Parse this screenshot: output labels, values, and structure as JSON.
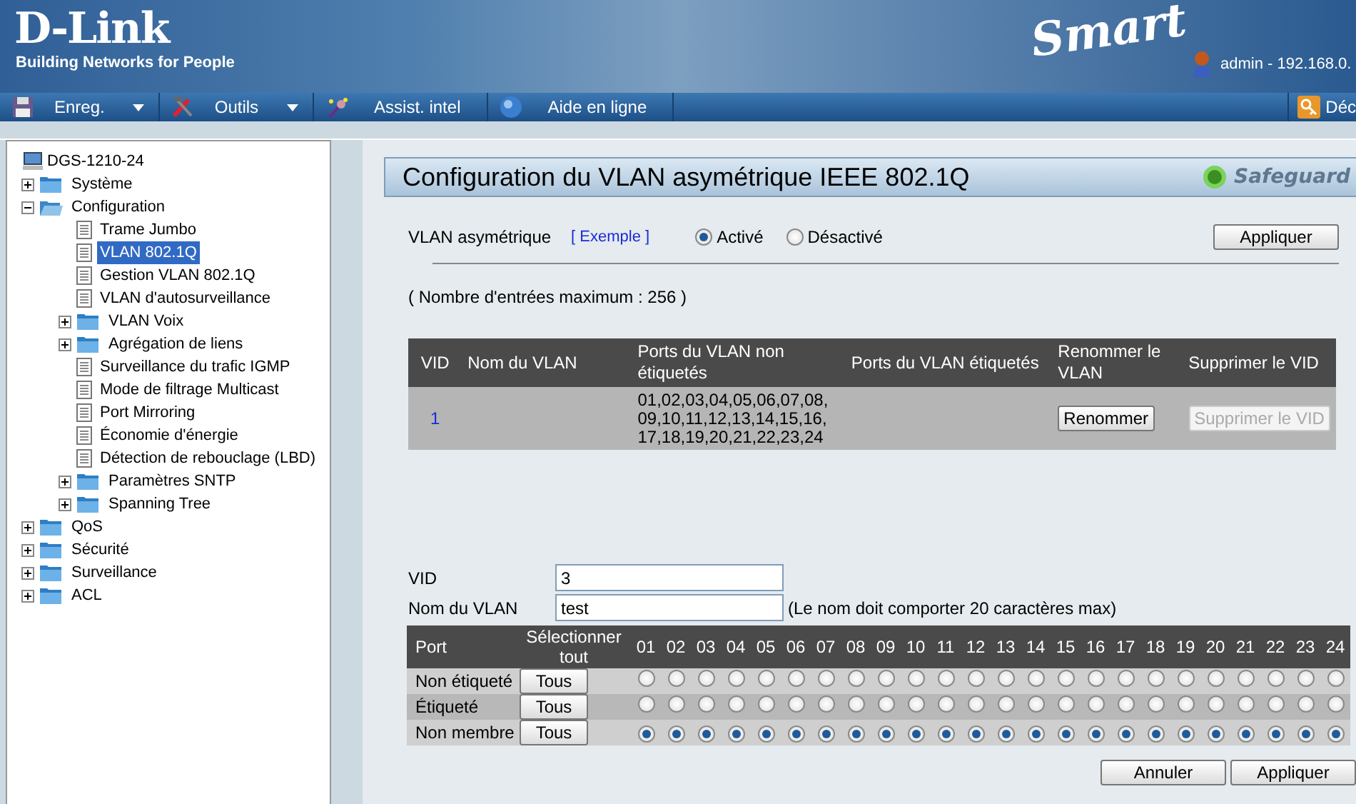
{
  "header": {
    "logo": "D-Link",
    "tagline": "Building Networks for People",
    "product": "Smart",
    "user": "admin - 192.168.0."
  },
  "toolbar": {
    "items": [
      {
        "kind": "save",
        "label": "Enreg.",
        "dropdown": true
      },
      {
        "kind": "tools",
        "label": "Outils",
        "dropdown": true
      },
      {
        "kind": "wizard",
        "label": "Assist. intel",
        "dropdown": false
      },
      {
        "kind": "help",
        "label": "Aide en ligne",
        "dropdown": false
      }
    ],
    "logout": "Déc"
  },
  "tree": {
    "label": "DGS-1210-24",
    "children": [
      {
        "kind": "folder",
        "label": "Système",
        "expanded": false,
        "selected": false
      },
      {
        "kind": "folder",
        "label": "Configuration",
        "expanded": true,
        "selected": false,
        "children": [
          {
            "kind": "page",
            "label": "Trame Jumbo",
            "selected": false
          },
          {
            "kind": "page",
            "label": "VLAN 802.1Q",
            "selected": true
          },
          {
            "kind": "page",
            "label": "Gestion VLAN 802.1Q",
            "selected": false
          },
          {
            "kind": "page",
            "label": "VLAN d'autosurveillance",
            "selected": false
          },
          {
            "kind": "folder",
            "label": "VLAN Voix",
            "expanded": false,
            "selected": false
          },
          {
            "kind": "folder",
            "label": "Agrégation de liens",
            "expanded": false,
            "selected": false
          },
          {
            "kind": "page",
            "label": "Surveillance du trafic IGMP",
            "selected": false
          },
          {
            "kind": "page",
            "label": "Mode de filtrage Multicast",
            "selected": false
          },
          {
            "kind": "page",
            "label": "Port Mirroring",
            "selected": false
          },
          {
            "kind": "page",
            "label": "Économie d'énergie",
            "selected": false
          },
          {
            "kind": "page",
            "label": "Détection de rebouclage (LBD)",
            "selected": false
          },
          {
            "kind": "folder",
            "label": "Paramètres SNTP",
            "expanded": false,
            "selected": false
          },
          {
            "kind": "folder",
            "label": "Spanning Tree",
            "expanded": false,
            "selected": false
          }
        ]
      },
      {
        "kind": "folder",
        "label": "QoS",
        "expanded": false,
        "selected": false
      },
      {
        "kind": "folder",
        "label": "Sécurité",
        "expanded": false,
        "selected": false
      },
      {
        "kind": "folder",
        "label": "Surveillance",
        "expanded": false,
        "selected": false
      },
      {
        "kind": "folder",
        "label": "ACL",
        "expanded": false,
        "selected": false
      }
    ]
  },
  "panel": {
    "title": "Configuration du VLAN asymétrique IEEE 802.1Q",
    "safeguard": "Safeguard"
  },
  "asymmetric": {
    "label": "VLAN asymétrique",
    "link": "[ Exemple ]",
    "options": [
      {
        "label": "Activé",
        "selected": true
      },
      {
        "label": "Désactivé",
        "selected": false
      }
    ],
    "apply": "Appliquer"
  },
  "max_entries": "( Nombre d'entrées maximum : 256 )",
  "vlan_table": {
    "columns": [
      "VID",
      "Nom du VLAN",
      "Ports du VLAN non étiquetés",
      "Ports du VLAN étiquetés",
      "Renommer le VLAN",
      "Supprimer le VID"
    ],
    "rows": [
      {
        "vid": "1",
        "untagged": "01,02,03,04,05,06,07,08, 09,10,11,12,13,14,15,16, 17,18,19,20,21,22,23,24",
        "rename": "Renommer",
        "delete": "Supprimer le VID",
        "delete_disabled": true
      }
    ]
  },
  "form": {
    "vid_label": "VID",
    "vid_value": "3",
    "name_label": "Nom du VLAN",
    "name_value": "test",
    "name_hint": "(Le nom doit comporter 20 caractères max)"
  },
  "port_table": {
    "port_header": "Port",
    "select_header": "Sélectionner tout",
    "ports": [
      "01",
      "02",
      "03",
      "04",
      "05",
      "06",
      "07",
      "08",
      "09",
      "10",
      "11",
      "12",
      "13",
      "14",
      "15",
      "16",
      "17",
      "18",
      "19",
      "20",
      "21",
      "22",
      "23",
      "24"
    ],
    "rows": [
      {
        "label": "Non étiqueté",
        "button": "Tous",
        "cells": [
          {
            "selected": false
          },
          {
            "selected": false
          },
          {
            "selected": false
          },
          {
            "selected": false
          },
          {
            "selected": false
          },
          {
            "selected": false
          },
          {
            "selected": false
          },
          {
            "selected": false
          },
          {
            "selected": false
          },
          {
            "selected": false
          },
          {
            "selected": false
          },
          {
            "selected": false
          },
          {
            "selected": false
          },
          {
            "selected": false
          },
          {
            "selected": false
          },
          {
            "selected": false
          },
          {
            "selected": false
          },
          {
            "selected": false
          },
          {
            "selected": false
          },
          {
            "selected": false
          },
          {
            "selected": false
          },
          {
            "selected": false
          },
          {
            "selected": false
          },
          {
            "selected": false
          }
        ]
      },
      {
        "label": "Étiqueté",
        "button": "Tous",
        "cells": [
          {
            "selected": false
          },
          {
            "selected": false
          },
          {
            "selected": false
          },
          {
            "selected": false
          },
          {
            "selected": false
          },
          {
            "selected": false
          },
          {
            "selected": false
          },
          {
            "selected": false
          },
          {
            "selected": false
          },
          {
            "selected": false
          },
          {
            "selected": false
          },
          {
            "selected": false
          },
          {
            "selected": false
          },
          {
            "selected": false
          },
          {
            "selected": false
          },
          {
            "selected": false
          },
          {
            "selected": false
          },
          {
            "selected": false
          },
          {
            "selected": false
          },
          {
            "selected": false
          },
          {
            "selected": false
          },
          {
            "selected": false
          },
          {
            "selected": false
          },
          {
            "selected": false
          }
        ]
      },
      {
        "label": "Non membre",
        "button": "Tous",
        "cells": [
          {
            "selected": true
          },
          {
            "selected": true
          },
          {
            "selected": true
          },
          {
            "selected": true
          },
          {
            "selected": true
          },
          {
            "selected": true
          },
          {
            "selected": true
          },
          {
            "selected": true
          },
          {
            "selected": true
          },
          {
            "selected": true
          },
          {
            "selected": true
          },
          {
            "selected": true
          },
          {
            "selected": true
          },
          {
            "selected": true
          },
          {
            "selected": true
          },
          {
            "selected": true
          },
          {
            "selected": true
          },
          {
            "selected": true
          },
          {
            "selected": true
          },
          {
            "selected": true
          },
          {
            "selected": true
          },
          {
            "selected": true
          },
          {
            "selected": true
          },
          {
            "selected": true
          }
        ]
      }
    ]
  },
  "buttons": [
    "Annuler",
    "Appliquer"
  ]
}
